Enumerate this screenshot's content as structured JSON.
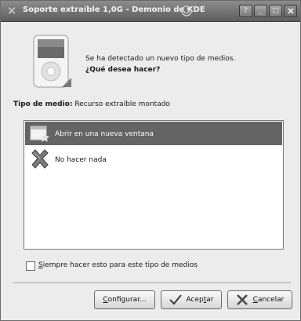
{
  "window": {
    "title": "Soporte extraíble 1,0G - Demonio de KDE",
    "buttons": {
      "help": "?",
      "minimize": "_",
      "maximize": "□"
    }
  },
  "header": {
    "detect_text": "Se ha detectado un nuevo tipo de medios.",
    "question": "¿Qué desea hacer?"
  },
  "media_type": {
    "label": "Tipo de medio:",
    "value": " Recurso extraíble montado"
  },
  "actions": [
    {
      "label": "Abrir en una nueva ventana",
      "icon": "new-window-icon",
      "selected": true
    },
    {
      "label": "No hacer nada",
      "icon": "x-cross-icon",
      "selected": false
    }
  ],
  "always_checkbox": {
    "mnemonic": "S",
    "rest": "iempre hacer esto para este tipo de medios",
    "checked": false
  },
  "buttons": {
    "configure": {
      "mnemonic": "C",
      "rest": "onfigurar..."
    },
    "accept": {
      "pre": "Acep",
      "mnemonic": "t",
      "post": "ar"
    },
    "cancel": {
      "mnemonic": "C",
      "rest": "ancelar"
    }
  },
  "colors": {
    "selection": "#646464",
    "titlebar": "#6e6e6e"
  }
}
